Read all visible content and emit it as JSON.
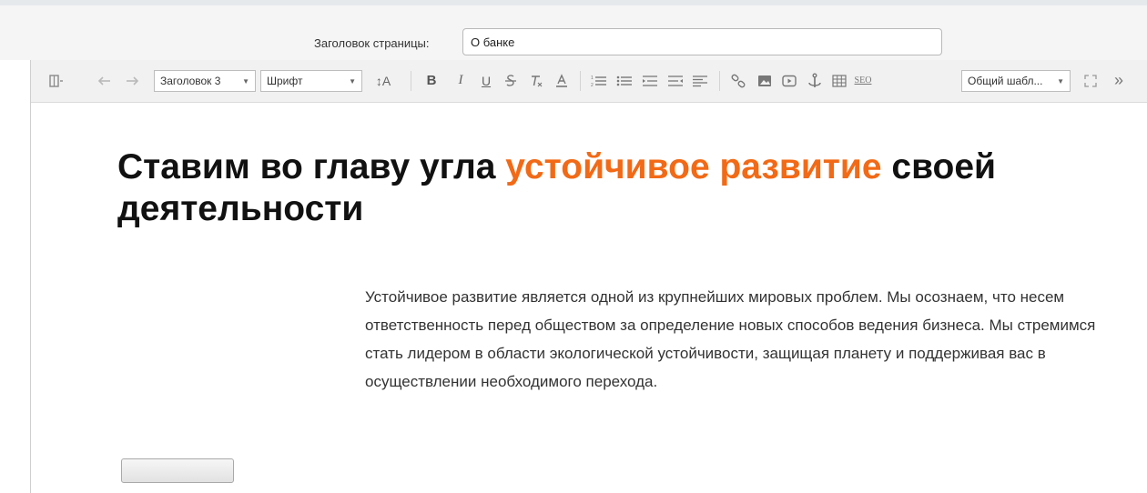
{
  "page_title": {
    "label": "Заголовок страницы:",
    "value": "О банке"
  },
  "toolbar": {
    "heading_select": "Заголовок 3",
    "font_select": "Шрифт",
    "font_size_label": "↕A",
    "bold": "B",
    "italic": "I",
    "underline": "U",
    "seo": "SEO",
    "template_select": "Общий шабл...",
    "more": "»"
  },
  "content": {
    "heading_part1": "Ставим во главу угла ",
    "heading_highlight": "устойчивое развитие",
    "heading_part2": " своей деятельности",
    "paragraph": "Устойчивое развитие является одной из крупнейших мировых проблем. Мы осознаем, что несем ответственность перед обществом за определение новых способов ведения бизнеса. Мы стремимся стать лидером в области экологической устойчивости, защищая планету и поддерживая вас в осуществлении необходимого перехода."
  },
  "colors": {
    "accent": "#f26a16",
    "text": "#111111"
  }
}
